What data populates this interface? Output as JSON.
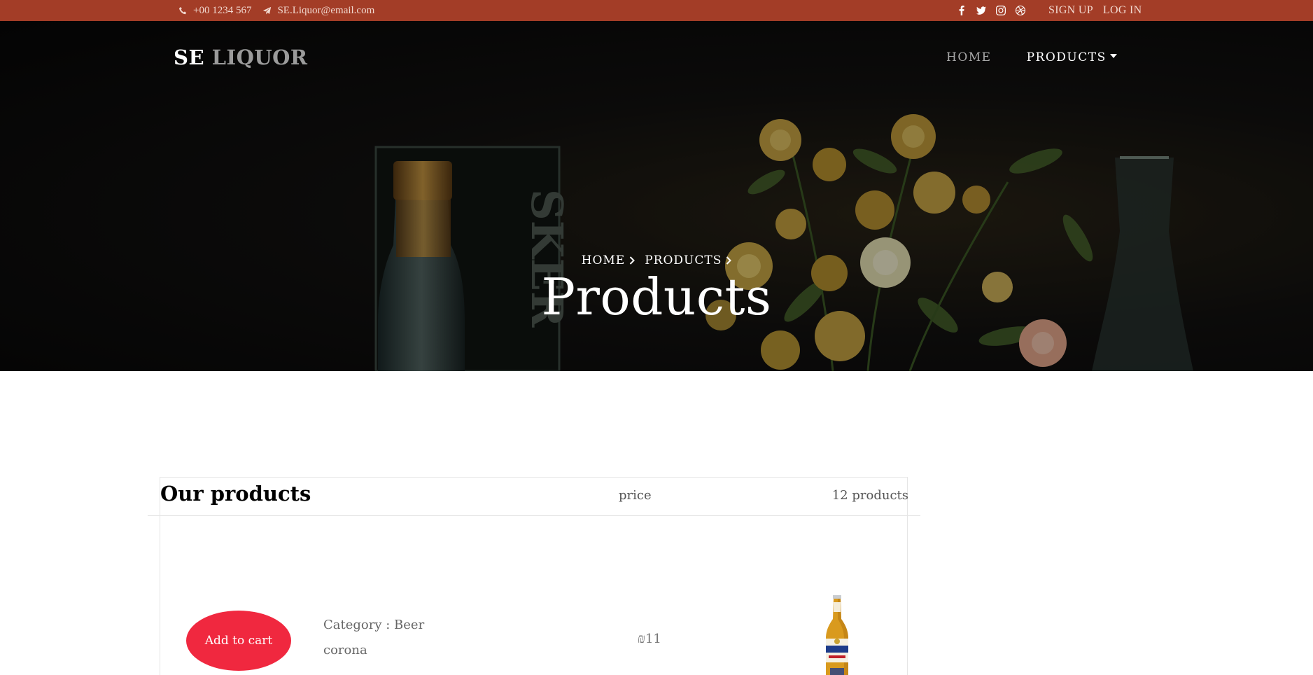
{
  "topbar": {
    "phone": "+00 1234 567",
    "email": "SE.Liquor@email.com",
    "social_icons": [
      "facebook-icon",
      "twitter-icon",
      "instagram-icon",
      "dribbble-icon"
    ],
    "signup": "SIGN UP",
    "login": "LOG IN",
    "background_color": "#a33d27"
  },
  "navbar": {
    "brand_first": "SE",
    "brand_second": "LIQUOR",
    "links": [
      {
        "label": "HOME"
      },
      {
        "label": "PRODUCTS"
      }
    ]
  },
  "hero": {
    "breadcrumb": [
      "HOME",
      "PRODUCTS"
    ],
    "title": "Products"
  },
  "products": {
    "heading": "Our products",
    "price_column": "price",
    "count_label": "12 products",
    "items": [
      {
        "button_label": "Add to cart",
        "category": "Category : Beer",
        "name": "corona",
        "price": "₪11"
      }
    ],
    "accent_color": "#f0283f"
  }
}
